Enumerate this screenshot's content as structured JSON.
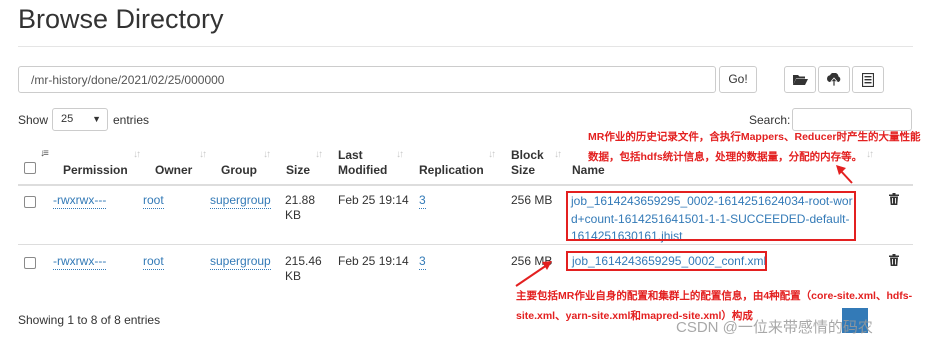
{
  "page": {
    "title": "Browse Directory"
  },
  "path_bar": {
    "value": "/mr-history/done/2021/02/25/000000",
    "go_label": "Go!"
  },
  "toolbar": [
    "folder-open-icon",
    "upload-icon",
    "list-icon"
  ],
  "table_controls": {
    "show_label": "Show",
    "page_length": "25",
    "entries_label": "entries",
    "search_label": "Search:",
    "search_value": ""
  },
  "columns": [
    "Permission",
    "Owner",
    "Group",
    "Size",
    "Last Modified",
    "Replication",
    "Block Size",
    "Name"
  ],
  "rows": [
    {
      "permission": "-rwxrwx---",
      "owner": "root",
      "group": "supergroup",
      "size": "21.88 KB",
      "modified": "Feb 25 19:14",
      "replication": "3",
      "block_size": "256 MB",
      "name": "job_1614243659295_0002-1614251624034-root-word+count-1614251641501-1-1-SUCCEEDED-default-1614251630161.jhist"
    },
    {
      "permission": "-rwxrwx---",
      "owner": "root",
      "group": "supergroup",
      "size": "215.46 KB",
      "modified": "Feb 25 19:14",
      "replication": "3",
      "block_size": "256 MB",
      "name": "job_1614243659295_0002_conf.xml"
    }
  ],
  "footer": {
    "info": "Showing 1 to 8 of 8 entries"
  },
  "annotations": {
    "top": "MR作业的历史记录文件，含执行Mappers、Reducer时产生的大量性能数据，包括hdfs统计信息，处理的数据量，分配的内存等。",
    "bottom": "主要包括MR作业自身的配置和集群上的配置信息，由4种配置（core-site.xml、hdfs-site.xml、yarn-site.xml和mapred-site.xml）构成",
    "color": "#e32020"
  },
  "watermark": "CSDN @一位来带感情的码农",
  "colors": {
    "link": "#337ab7",
    "accent": "#337ab7"
  }
}
